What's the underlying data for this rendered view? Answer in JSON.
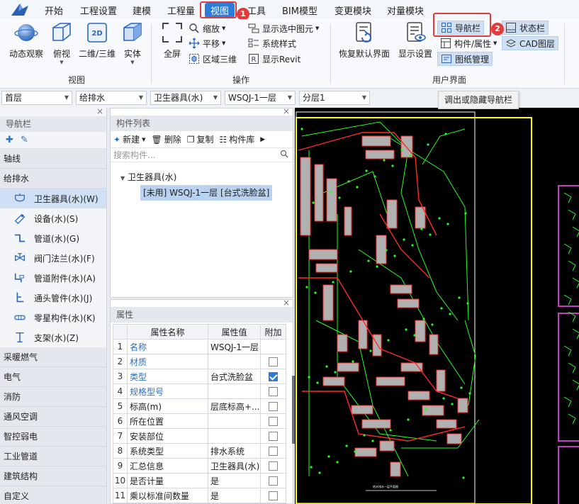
{
  "menu": {
    "items": [
      "开始",
      "工程设置",
      "建模",
      "工程量",
      "视图",
      "工具",
      "BIM模型",
      "变更模块",
      "对量模块"
    ],
    "active": "视图"
  },
  "badges": {
    "step1": "1",
    "step2": "2"
  },
  "ribbon": {
    "view": {
      "orbit": "动态观察",
      "top_view": "俯视",
      "toggle_2d3d": "二维/三维",
      "solid": "实体",
      "label_2d": "2D",
      "group": "视图"
    },
    "ops": {
      "fullscreen": "全屏",
      "zoom": "缩放",
      "pan": "平移",
      "area_3d": "区域三维",
      "show_selected": "显示选中图元",
      "system_style": "系统样式",
      "show_revit": "显示Revit",
      "group": "操作"
    },
    "ui": {
      "restore": "恢复默认界面",
      "display_settings": "显示设置",
      "nav_bar": "导航栏",
      "component_props": "构件/属性",
      "drawing_mgmt": "图纸管理",
      "status_bar": "状态栏",
      "cad_layer": "CAD图层",
      "group": "用户界面"
    },
    "tooltip": "调出或隐藏导航栏"
  },
  "dropdowns": [
    "首层",
    "给排水",
    "卫生器具(水)",
    "WSQJ-1一层",
    "分层1"
  ],
  "nav": {
    "title": "导航栏",
    "sections_top": [
      "轴线",
      "给排水"
    ],
    "items": [
      {
        "label": "卫生器具(水)(W)",
        "icon": "sanitary-fixture-icon",
        "selected": true
      },
      {
        "label": "设备(水)(S)",
        "icon": "equipment-icon"
      },
      {
        "label": "管道(水)(G)",
        "icon": "pipe-icon"
      },
      {
        "label": "阀门法兰(水)(F)",
        "icon": "valve-icon"
      },
      {
        "label": "管道附件(水)(A)",
        "icon": "pipe-fitting-icon"
      },
      {
        "label": "通头管件(水)(J)",
        "icon": "tee-fitting-icon"
      },
      {
        "label": "零星构件(水)(K)",
        "icon": "misc-component-icon"
      },
      {
        "label": "支架(水)(Z)",
        "icon": "bracket-icon"
      }
    ],
    "sections_bottom": [
      "采暖燃气",
      "电气",
      "消防",
      "通风空调",
      "智控弱电",
      "工业管道",
      "建筑结构",
      "自定义"
    ]
  },
  "complist": {
    "title": "构件列表",
    "new": "新建",
    "delete": "删除",
    "copy": "复制",
    "library": "构件库",
    "search_placeholder": "搜索构件...",
    "tree_root": "卫生器具(水)",
    "tree_leaf": "[未用] WSQJ-1一层 [台式洗脸盆]"
  },
  "props": {
    "title": "属性",
    "headers": [
      "属性名称",
      "属性值",
      "附加"
    ],
    "rows": [
      {
        "n": "1",
        "name": "名称",
        "value": "WSQJ-1一层",
        "blue": true,
        "check": null
      },
      {
        "n": "2",
        "name": "材质",
        "value": "",
        "blue": true,
        "check": false
      },
      {
        "n": "3",
        "name": "类型",
        "value": "台式洗脸盆",
        "blue": true,
        "check": true
      },
      {
        "n": "4",
        "name": "规格型号",
        "value": "",
        "blue": true,
        "check": false
      },
      {
        "n": "5",
        "name": "标高(m)",
        "value": "层底标高+...",
        "blue": false,
        "check": false
      },
      {
        "n": "6",
        "name": "所在位置",
        "value": "",
        "blue": false,
        "check": false
      },
      {
        "n": "7",
        "name": "安装部位",
        "value": "",
        "blue": false,
        "check": false
      },
      {
        "n": "8",
        "name": "系统类型",
        "value": "排水系统",
        "blue": false,
        "check": false
      },
      {
        "n": "9",
        "name": "汇总信息",
        "value": "卫生器具(水)",
        "blue": false,
        "check": false
      },
      {
        "n": "10",
        "name": "是否计量",
        "value": "是",
        "blue": false,
        "check": false
      },
      {
        "n": "11",
        "name": "乘以标准间数量",
        "value": "是",
        "blue": false,
        "check": false
      }
    ]
  },
  "canvas": {
    "sheet_label": "给水排水一层平面图",
    "colors": {
      "bg": "#000000",
      "frame": "#ffff00",
      "wall": "#ff2a2a",
      "pipe": "#22ff22",
      "room": "#b0b0b0",
      "border": "#c040c0"
    }
  }
}
